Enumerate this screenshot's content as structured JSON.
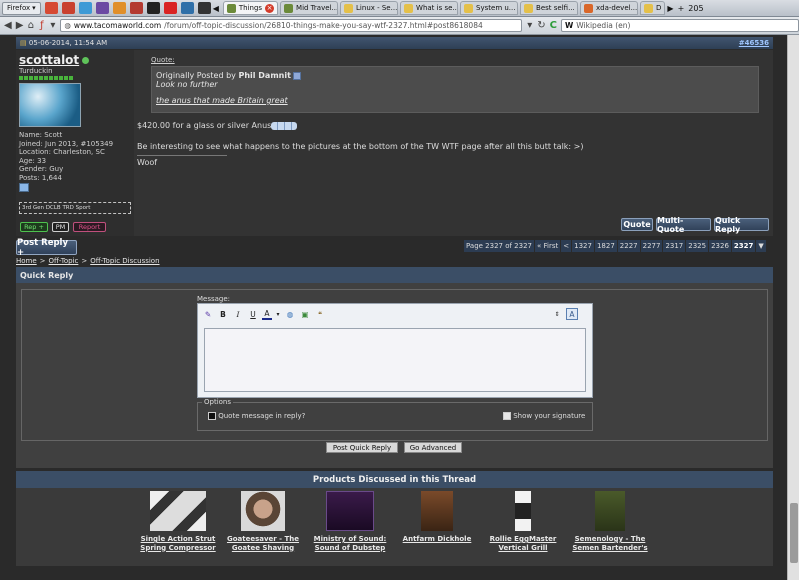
{
  "browser": {
    "app_button": "Firefox",
    "tabs": [
      {
        "label": "Things",
        "active": true
      },
      {
        "label": "Mid Travel..."
      },
      {
        "label": "Linux - Se..."
      },
      {
        "label": "What is se..."
      },
      {
        "label": "System u..."
      },
      {
        "label": "Best selfi..."
      },
      {
        "label": "xda-devel..."
      },
      {
        "label": "D"
      }
    ],
    "tab_count": "205",
    "url_host": "www.tacomaworld.com",
    "url_path": "/forum/off-topic-discussion/26810-things-make-you-say-wtf-2327.html#post8618084",
    "search_engine": "Wikipedia (en)"
  },
  "post": {
    "date": "05-06-2014, 11:54 AM",
    "number": "#46536",
    "author": {
      "username": "scottalot",
      "rank": "Turduckin",
      "name": "Name: Scott",
      "joined": "Joined: Jun 2013, #105349",
      "location": "Location: Charleston, SC",
      "age": "Age: 33",
      "gender": "Gender: Guy",
      "posts": "Posts: 1,644",
      "signature_box": "3rd Gen DCLB TRD Sport"
    },
    "quote_label": "Quote:",
    "quote_prefix": "Originally Posted by",
    "quote_author": "Phil Damnit",
    "quote_line1": "Look no further",
    "quote_line2": "the anus that made Britain great",
    "reply_text": "$420.00 for a glass or silver Anus",
    "reply_text2": "Be interesting to see what happens to the pictures at the bottom of the TW WTF page after all this butt talk: >)",
    "signature": "Woof",
    "small_buttons": [
      "Rep +",
      "PM",
      "Report"
    ],
    "buttons": {
      "quote": "Quote",
      "multi_quote": "Multi-Quote",
      "quick_reply": "Quick Reply"
    }
  },
  "post_reply_button": "Post Reply +",
  "pagination": [
    "Page 2327 of 2327",
    "« First",
    "<",
    "1327",
    "1827",
    "2227",
    "2277",
    "2317",
    "2325",
    "2326",
    "2327",
    "▼"
  ],
  "breadcrumb": [
    "Home",
    ">",
    "Off-Topic",
    ">",
    "Off-Topic Discussion"
  ],
  "quick_reply": {
    "title": "Quick Reply",
    "message_label": "Message:",
    "options_legend": "Options",
    "quote_option": "Quote message in reply?",
    "signature_option": "Show your signature",
    "post_button": "Post Quick Reply",
    "advanced_button": "Go Advanced"
  },
  "products": {
    "title": "Products Discussed in this Thread",
    "items": [
      {
        "name": "Single Action Strut Spring Compressor"
      },
      {
        "name": "Goateesaver - The Goatee Shaving"
      },
      {
        "name": "Ministry of Sound: Sound of Dubstep"
      },
      {
        "name": "Antfarm Dickhole"
      },
      {
        "name": "Rollie EggMaster Vertical Grill"
      },
      {
        "name": "Semenology - The Semen Bartender's"
      }
    ]
  }
}
